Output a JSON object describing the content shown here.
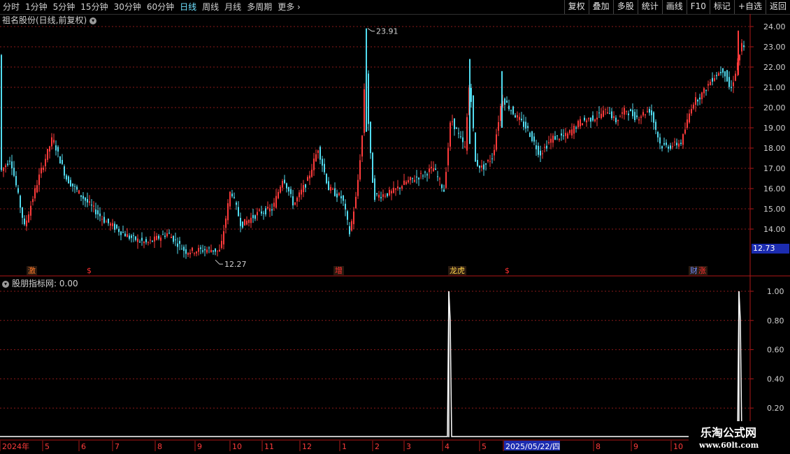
{
  "toolbar": {
    "periods": [
      "分时",
      "1分钟",
      "5分钟",
      "15分钟",
      "30分钟",
      "60分钟",
      "日线",
      "周线",
      "月线",
      "多周期",
      "更多"
    ],
    "active_period": "日线",
    "buttons": [
      "复权",
      "叠加",
      "多股",
      "统计",
      "画线",
      "F10",
      "标记",
      "+自选",
      "返回"
    ]
  },
  "main_panel": {
    "title": "祖名股份(日线,前复权)",
    "price_labels": [
      "24.00",
      "23.00",
      "22.00",
      "21.00",
      "20.00",
      "19.00",
      "18.00",
      "17.00",
      "16.00",
      "15.00",
      "14.00"
    ],
    "current_price": "12.73",
    "high_label": "23.91",
    "low_label": "12.27",
    "event_tags": [
      {
        "text": "激",
        "color": "#ff7a2a"
      },
      {
        "text": "$",
        "color": "#ff3030"
      },
      {
        "text": "增",
        "color": "#ff3030"
      },
      {
        "text": "龙虎",
        "color": "#ffd24a"
      },
      {
        "text": "$",
        "color": "#ff3030"
      },
      {
        "text": "财",
        "color": "#6a8cff"
      },
      {
        "text": "涨",
        "color": "#ff3030"
      }
    ]
  },
  "sub_panel": {
    "title": "股朋指标网",
    "value_text": ": 0.00",
    "axis_labels": [
      "1.00",
      "0.80",
      "0.60",
      "0.40",
      "0.20"
    ]
  },
  "date_axis": {
    "labels": [
      "2024年",
      "5",
      "6",
      "7",
      "8",
      "9",
      "10",
      "11",
      "12",
      "1",
      "2",
      "3",
      "4",
      "5",
      "2025/05/22/四",
      "8",
      "9",
      "10"
    ]
  },
  "watermark": {
    "line1": "乐淘公式网",
    "line2": "www.60lt.com"
  },
  "colors": {
    "up": "#ff3b3b",
    "down": "#52dcf0",
    "grid": "#8a1a1a",
    "axis": "#b01818",
    "signal": "#ffffff",
    "date_highlight": "#1c2cb0"
  }
}
